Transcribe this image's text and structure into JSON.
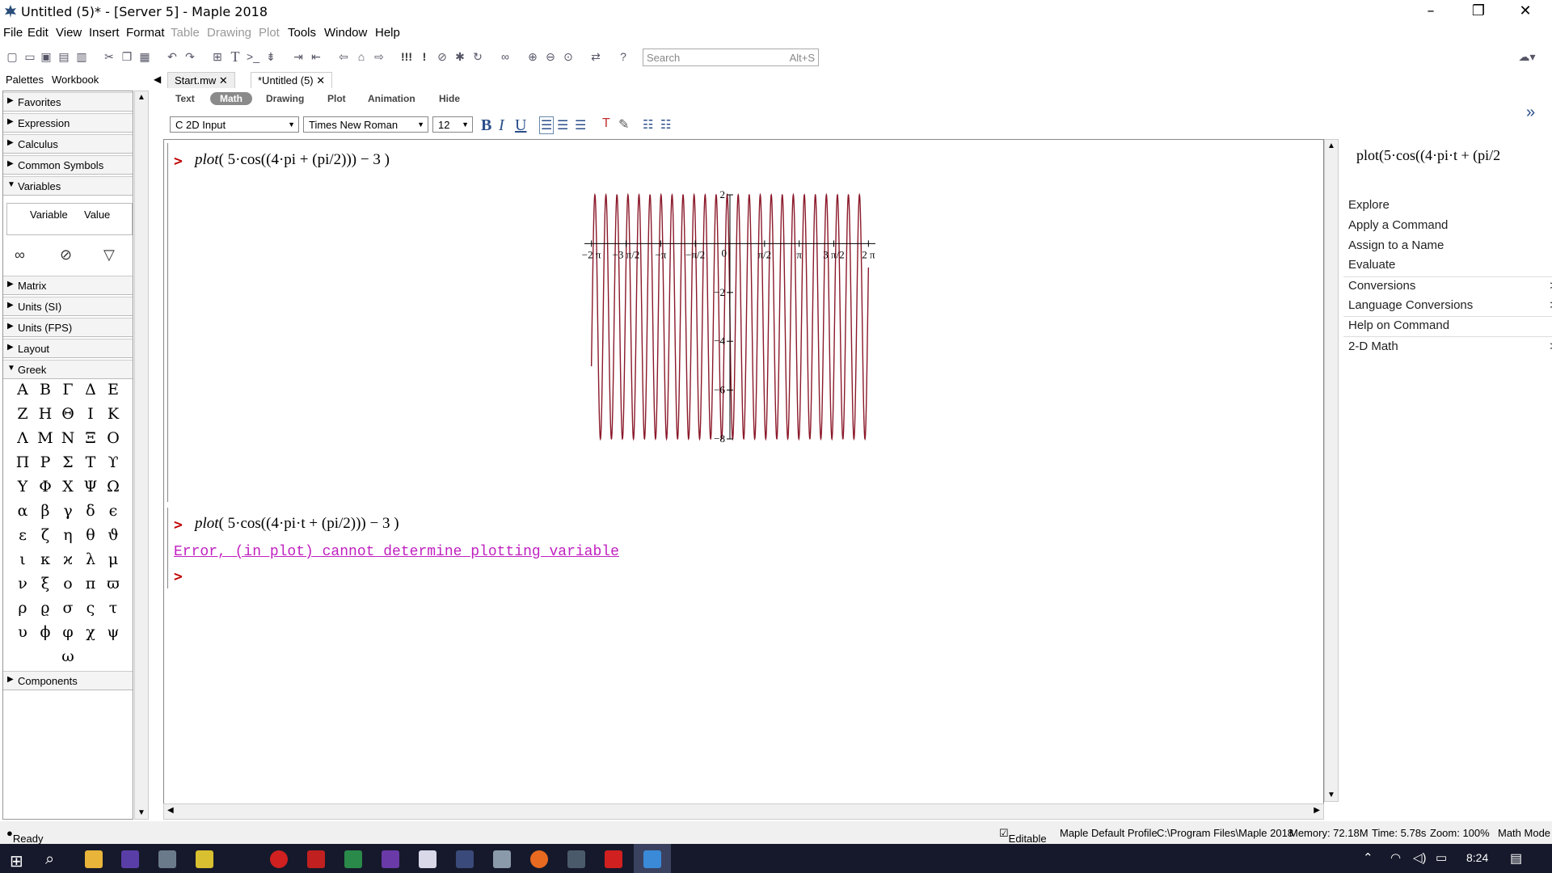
{
  "window": {
    "title": "Untitled (5)* - [Server 5] - Maple 2018"
  },
  "menu": [
    "File",
    "Edit",
    "View",
    "Insert",
    "Format",
    "Table",
    "Drawing",
    "Plot",
    "Tools",
    "Window",
    "Help"
  ],
  "search": {
    "placeholder": "Search",
    "shortcut": "Alt+S"
  },
  "palette_tabs": [
    "Palettes",
    "Workbook"
  ],
  "palettes": {
    "favorites": "Favorites",
    "expression": "Expression",
    "calculus": "Calculus",
    "common_symbols": "Common Symbols",
    "variables": "Variables",
    "var_col": "Variable",
    "val_col": "Value",
    "matrix": "Matrix",
    "units_si": "Units (SI)",
    "units_fps": "Units (FPS)",
    "layout": "Layout",
    "greek": "Greek",
    "components": "Components"
  },
  "greek_rows": [
    [
      "Α",
      "Β",
      "Γ",
      "Δ",
      "Ε"
    ],
    [
      "Ζ",
      "Η",
      "Θ",
      "Ι",
      "Κ"
    ],
    [
      "Λ",
      "Μ",
      "Ν",
      "Ξ",
      "Ο"
    ],
    [
      "Π",
      "Ρ",
      "Σ",
      "Τ",
      "ϒ"
    ],
    [
      "Υ",
      "Φ",
      "Χ",
      "Ψ",
      "Ω"
    ],
    [
      "α",
      "β",
      "γ",
      "δ",
      "ϵ"
    ],
    [
      "ε",
      "ζ",
      "η",
      "θ",
      "ϑ"
    ],
    [
      "ι",
      "κ",
      "ϰ",
      "λ",
      "μ"
    ],
    [
      "ν",
      "ξ",
      "ο",
      "π",
      "ϖ"
    ],
    [
      "ρ",
      "ϱ",
      "σ",
      "ς",
      "τ"
    ],
    [
      "υ",
      "ϕ",
      "φ",
      "χ",
      "ψ"
    ],
    [
      "ω"
    ]
  ],
  "doc_tabs": [
    "Start.mw",
    "*Untitled (5)"
  ],
  "mode_bar": [
    "Text",
    "Math",
    "Drawing",
    "Plot",
    "Animation",
    "Hide"
  ],
  "format_bar": {
    "input_mode": "C  2D Input",
    "font": "Times New Roman",
    "size": "12"
  },
  "worksheet": {
    "prompt": ">",
    "input1": {
      "fn": "plot",
      "expr": "5·cos((4·pi + (pi/2))) − 3"
    },
    "input2": {
      "fn": "plot",
      "expr": "5·cos((4·pi·t + (pi/2))) − 3"
    },
    "error": "Error, (in plot) cannot determine plotting variable"
  },
  "chart_data": {
    "type": "line",
    "title": "",
    "xlabel": "",
    "ylabel": "",
    "xlim": [
      -6.6,
      6.6
    ],
    "ylim": [
      -8,
      2
    ],
    "x_ticks": [
      "−2 π",
      "−3 π/2",
      "−π",
      "−π/2",
      "0",
      "π/2",
      "π",
      "3 π/2",
      "2 π"
    ],
    "y_ticks": [
      "2",
      "−2",
      "−4",
      "−6",
      "−8"
    ],
    "series": [
      {
        "expression": "5·cos(4·pi·t + pi/2) − 3",
        "color": "#8b1a2b"
      }
    ]
  },
  "context_panel": {
    "preview": "plot(5·cos((4·pi·t + (pi/2",
    "items": [
      "Explore",
      "Apply a Command",
      "Assign to a Name",
      "Evaluate",
      "Conversions",
      "Language Conversions",
      "Help on Command",
      "2-D Math"
    ]
  },
  "status": {
    "ready": "Ready",
    "editable": "Editable",
    "profile": "Maple Default Profile",
    "path": "C:\\Program Files\\Maple 2018",
    "memory": "Memory: 72.18M",
    "time": "Time: 5.78s",
    "zoom": "Zoom: 100%",
    "mode": "Math Mode"
  },
  "taskbar": {
    "clock": "8:24"
  }
}
